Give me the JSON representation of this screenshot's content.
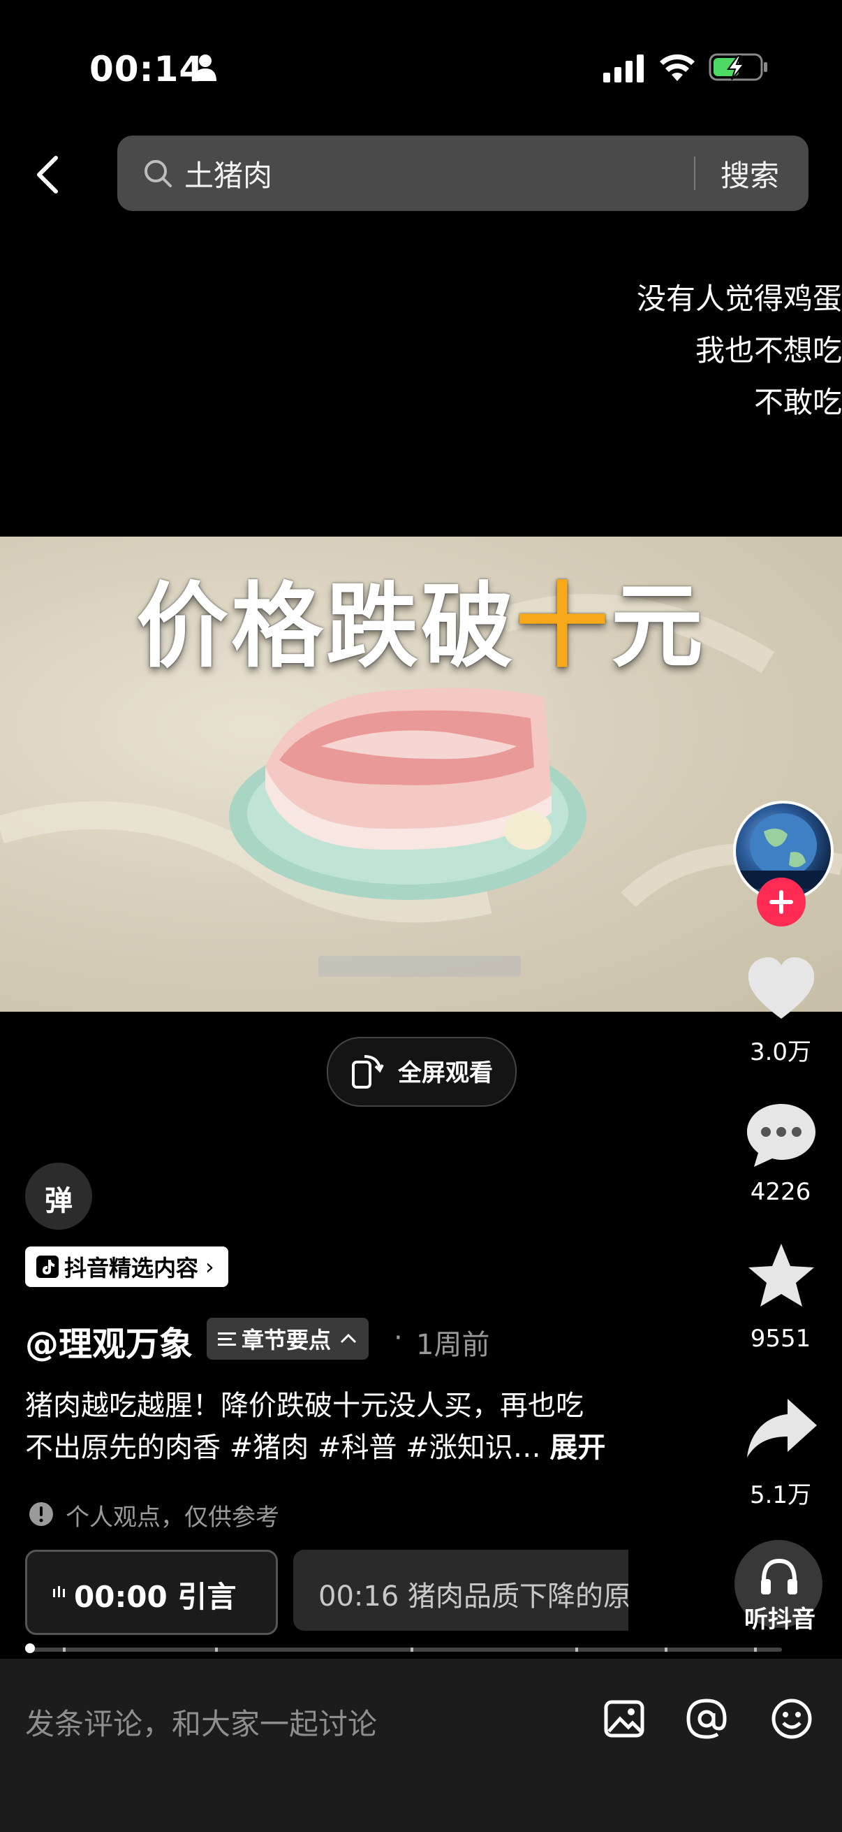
{
  "status": {
    "time": "00:14"
  },
  "search": {
    "query": "土猪肉",
    "button": "搜索"
  },
  "overflow_text": [
    "没有人觉得鸡蛋",
    "我也不想吃",
    "不敢吃"
  ],
  "video": {
    "title_a": "价格跌破",
    "title_b": "十",
    "title_c": "元",
    "fullscreen": "全屏观看"
  },
  "rail": {
    "likes": "3.0万",
    "comments": "4226",
    "favorites": "9551",
    "shares": "5.1万",
    "listen": "听抖音"
  },
  "info": {
    "danmu": "弹",
    "tag": "抖音精选内容",
    "author": "@理观万象",
    "chapter": "章节要点",
    "dot": "·",
    "time_ago": "1周前",
    "desc_line1": "猪肉越吃越腥！降价跌破十元没人买，再也吃",
    "desc_line2": "不出原先的肉香 #猪肉 #科普 #涨知识…",
    "expand": "展开",
    "notice": "个人观点，仅供参考",
    "chapter1": "00:00 引言",
    "chapter2": "00:16 猪肉品质下降的原"
  },
  "comment_placeholder": "发条评论，和大家一起讨论",
  "colors": {
    "accent": "#fe2c55",
    "highlight": "#f7a81b"
  }
}
